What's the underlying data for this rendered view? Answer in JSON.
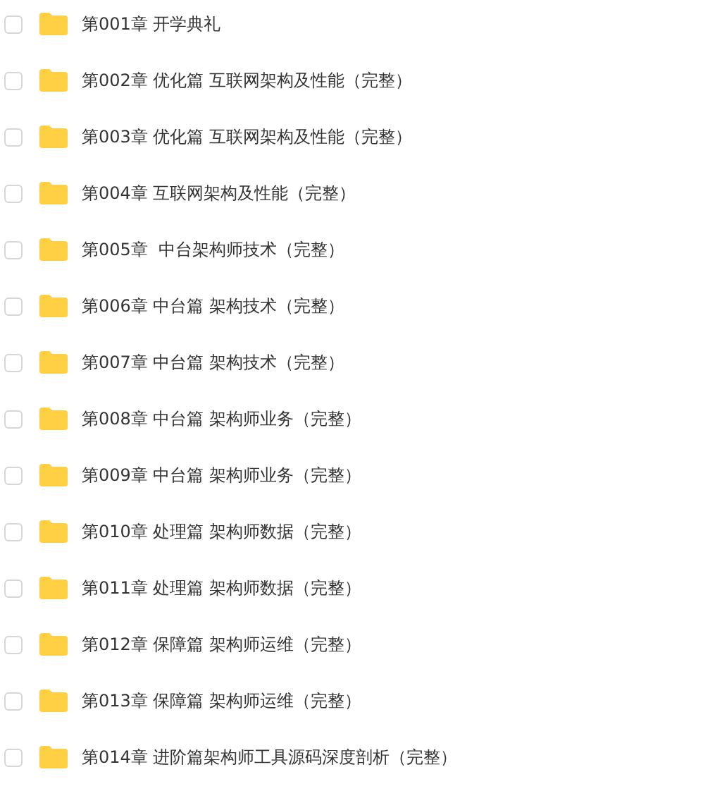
{
  "folders": [
    {
      "name": "第001章 开学典礼",
      "checked": false
    },
    {
      "name": "第002章 优化篇 互联网架构及性能（完整）",
      "checked": false
    },
    {
      "name": "第003章 优化篇 互联网架构及性能（完整）",
      "checked": false
    },
    {
      "name": "第004章 互联网架构及性能（完整）",
      "checked": false
    },
    {
      "name": "第005章  中台架构师技术（完整）",
      "checked": false
    },
    {
      "name": "第006章 中台篇 架构技术（完整）",
      "checked": false
    },
    {
      "name": "第007章 中台篇 架构技术（完整）",
      "checked": false
    },
    {
      "name": "第008章 中台篇 架构师业务（完整）",
      "checked": false
    },
    {
      "name": "第009章 中台篇 架构师业务（完整）",
      "checked": false
    },
    {
      "name": "第010章 处理篇 架构师数据（完整）",
      "checked": false
    },
    {
      "name": "第011章 处理篇 架构师数据（完整）",
      "checked": false
    },
    {
      "name": "第012章 保障篇 架构师运维（完整）",
      "checked": false
    },
    {
      "name": "第013章 保障篇 架构师运维（完整）",
      "checked": false
    },
    {
      "name": "第014章 进阶篇架构师工具源码深度剖析（完整）",
      "checked": false
    }
  ]
}
